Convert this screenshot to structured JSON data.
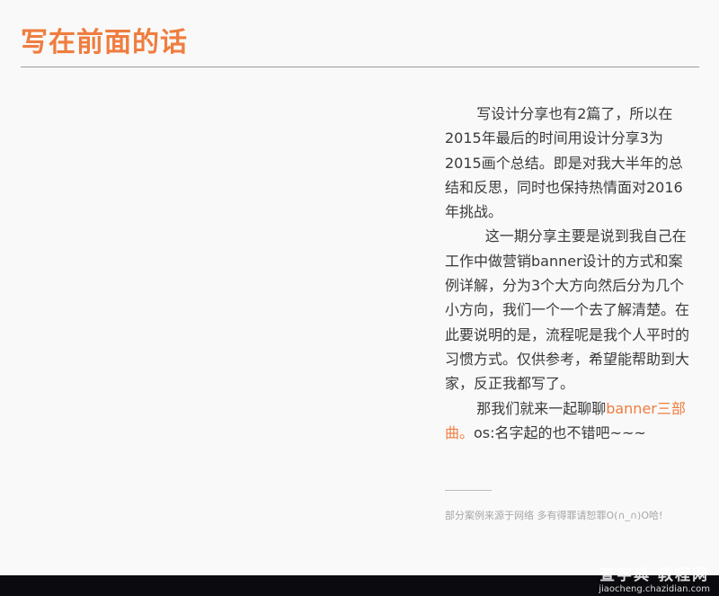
{
  "heading": "写在前面的话",
  "paragraphs": {
    "p1": "写设计分享也有2篇了，所以在2015年最后的时间用设计分享3为2015画个总结。即是对我大半年的总结和反思，同时也保持热情面对2016年挑战。",
    "p2": "这一期分享主要是说到我自己在工作中做营销banner设计的方式和案例详解，分为3个大方向然后分为几个小方向，我们一个一个去了解清楚。在此要说明的是，流程呢是我个人平时的习惯方式。仅供参考，希望能帮助到大家，反正我都写了。",
    "p3_before": "那我们就来一起聊聊",
    "p3_accent": "banner三部曲。",
    "p3_after": "os:名字起的也不错吧~~~"
  },
  "note": "部分案例来源于网络 多有得罪请恕罪O(∩_∩)O哈!",
  "watermark": {
    "name": "查字典 教程网",
    "url": "jiaocheng.chazidian.com"
  },
  "colors": {
    "accent": "#ef7d3f",
    "text": "#3a3a3a",
    "background": "#f9f9f9",
    "footer": "#0b0b0f"
  }
}
